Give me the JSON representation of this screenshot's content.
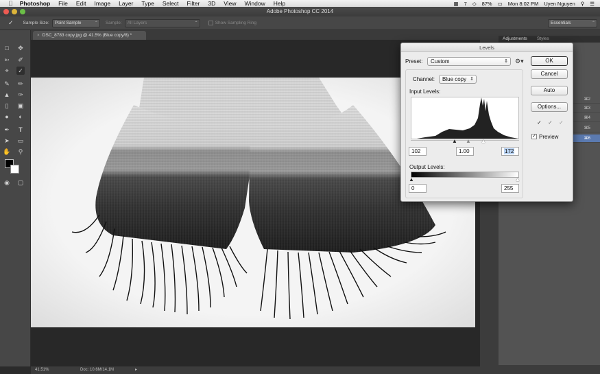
{
  "menubar": {
    "app_name": "Photoshop",
    "items": [
      "File",
      "Edit",
      "Image",
      "Layer",
      "Type",
      "Select",
      "Filter",
      "3D",
      "View",
      "Window",
      "Help"
    ],
    "status_items": [
      "7",
      "87%",
      "Mon 8:02 PM",
      "Uyen Nguyen"
    ]
  },
  "window": {
    "title": "Adobe Photoshop CC 2014"
  },
  "options_bar": {
    "sample_size_label": "Sample Size:",
    "sample_size_value": "Point Sample",
    "sample_label": "Sample:",
    "sample_value": "All Layers",
    "show_ring_label": "Show Sampling Ring",
    "workspace": "Essentials"
  },
  "document_tab": {
    "label": "DSC_8783 copy.jpg @ 41.5% (Blue copy/8) *"
  },
  "status_bar": {
    "zoom": "41.51%",
    "doc_size": "Doc: 10.6M/14.1M"
  },
  "panels": {
    "tabs": [
      "Adjustments",
      "Styles"
    ],
    "shortcuts": [
      "⌘2",
      "⌘3",
      "⌘4",
      "⌘5",
      "⌘6"
    ]
  },
  "levels_dialog": {
    "title": "Levels",
    "preset_label": "Preset:",
    "preset_value": "Custom",
    "channel_label": "Channel:",
    "channel_value": "Blue copy",
    "input_levels_label": "Input Levels:",
    "input_black": "102",
    "input_gamma": "1.00",
    "input_white": "172",
    "output_levels_label": "Output Levels:",
    "output_black": "0",
    "output_white": "255",
    "buttons": {
      "ok": "OK",
      "cancel": "Cancel",
      "auto": "Auto",
      "options": "Options..."
    },
    "preview_label": "Preview",
    "preview_checked": true
  },
  "colors": {
    "accent_selected": "#5b7ab0",
    "dialog_bg": "#ececec",
    "ui_dark": "#474747"
  }
}
